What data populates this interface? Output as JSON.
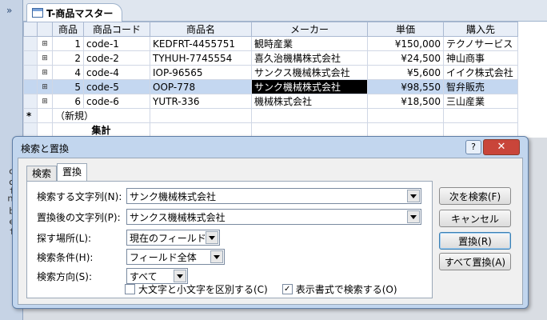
{
  "nav": {
    "vertical_text": "ｑｄｆｍ ｂ ｅｆ"
  },
  "doc_tab": {
    "title": "T-商品マスター"
  },
  "grid": {
    "headers": [
      "商品",
      "商品コード",
      "商品名",
      "メーカー",
      "単価",
      "購入先"
    ],
    "rows": [
      {
        "id": "1",
        "code": "code-1",
        "name": "KEDFRT-4455751",
        "maker": "観時産業",
        "price": "¥150,000",
        "vendor": "テクノサービス"
      },
      {
        "id": "2",
        "code": "code-2",
        "name": "TYHUH-7745554",
        "maker": "喜久治機構株式会社",
        "price": "¥24,500",
        "vendor": "神山商事"
      },
      {
        "id": "4",
        "code": "code-4",
        "name": "IOP-96565",
        "maker": "サンクス機械株式会社",
        "price": "¥5,600",
        "vendor": "イイク株式会社"
      },
      {
        "id": "5",
        "code": "code-5",
        "name": "OOP-778",
        "maker": "サンク機械株式会社",
        "price": "¥98,550",
        "vendor": "智弁販売"
      },
      {
        "id": "6",
        "code": "code-6",
        "name": "YUTR-336",
        "maker": "機械株式会社",
        "price": "¥18,500",
        "vendor": "三山産業"
      }
    ],
    "new_row": "（新規）",
    "total_row": "集計"
  },
  "dialog": {
    "title": "検索と置換",
    "help": "?",
    "close": "✕",
    "tabs": [
      "検索",
      "置換"
    ],
    "find_label": "検索する文字列(N):",
    "find_value": "サンク機械株式会社",
    "replace_label": "置換後の文字列(P):",
    "replace_value": "サンクス機械株式会社",
    "lookin_label": "探す場所(L):",
    "lookin_value": "現在のフィールド",
    "match_label": "検索条件(H):",
    "match_value": "フィールド全体",
    "direction_label": "検索方向(S):",
    "direction_value": "すべて",
    "case_label": "大文字と小文字を区別する(C)",
    "format_label": "表示書式で検索する(O)",
    "buttons": {
      "find_next": "次を検索(F)",
      "cancel": "キャンセル",
      "replace": "置換(R)",
      "replace_all": "すべて置換(A)"
    }
  }
}
